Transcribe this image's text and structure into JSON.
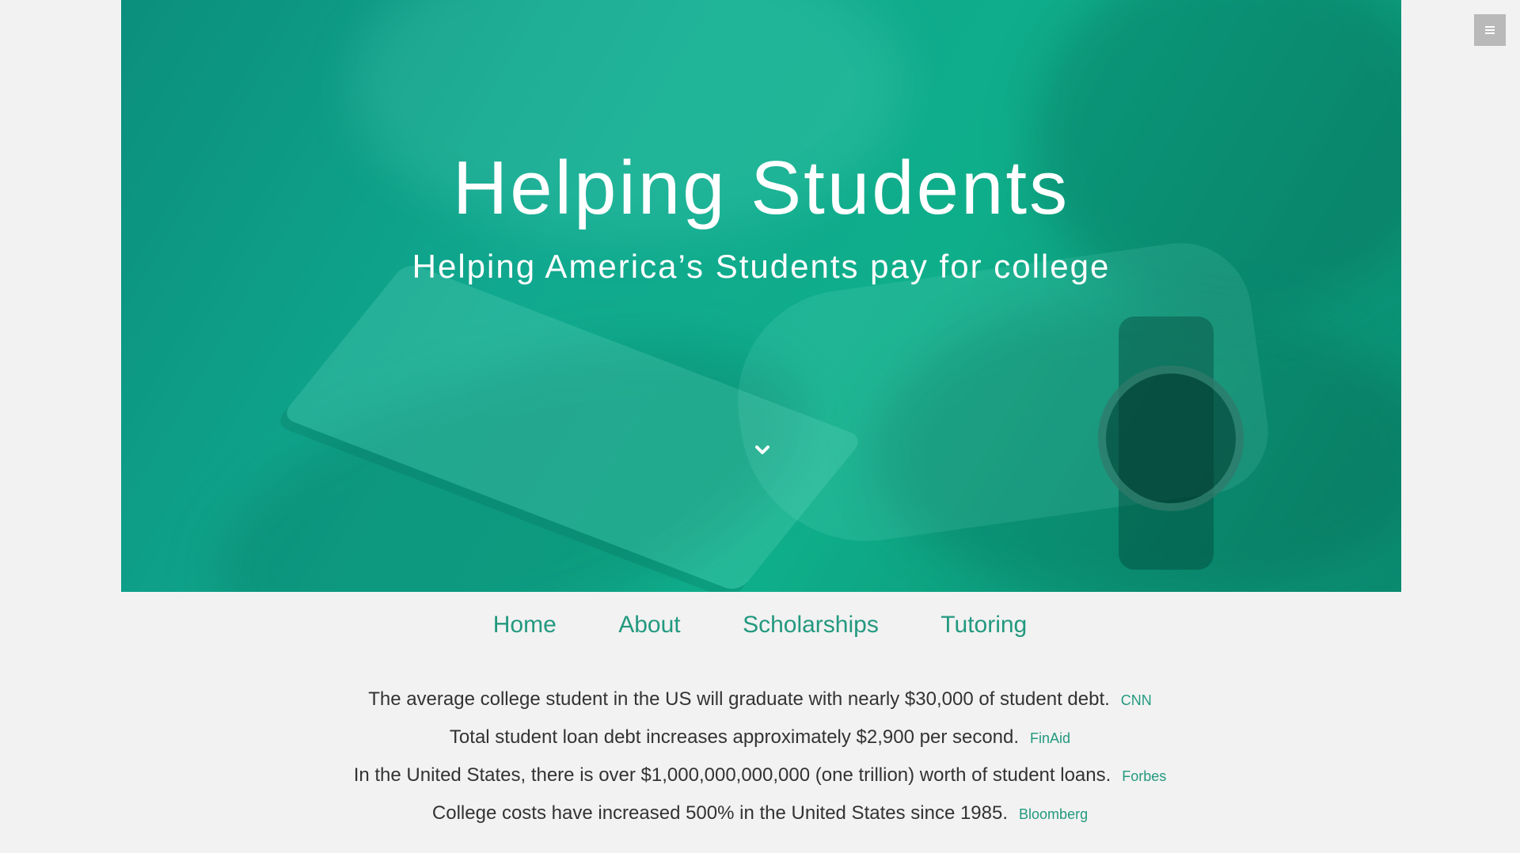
{
  "hero": {
    "title": "Helping Students",
    "subtitle": "Helping America’s Students pay for college",
    "overlay_color": "#10a98f",
    "scroll_icon": "chevron-down-icon"
  },
  "menu_toggle": {
    "icon": "hamburger-menu-icon",
    "color": "#b9b9b9"
  },
  "nav": {
    "items": [
      {
        "label": "Home"
      },
      {
        "label": "About"
      },
      {
        "label": "Scholarships"
      },
      {
        "label": "Tutoring"
      }
    ],
    "color": "#23997f"
  },
  "facts": [
    {
      "text": "The average college student in the US will graduate with nearly $30,000 of student debt.",
      "source": "CNN"
    },
    {
      "text": "Total student loan debt increases approximately $2,900 per second.",
      "source": "FinAid"
    },
    {
      "text": "In the United States, there is over $1,000,000,000,000 (one trillion) worth of student loans.",
      "source": "Forbes"
    },
    {
      "text": "College costs have increased 500% in the United States since 1985.",
      "source": "Bloomberg"
    }
  ]
}
